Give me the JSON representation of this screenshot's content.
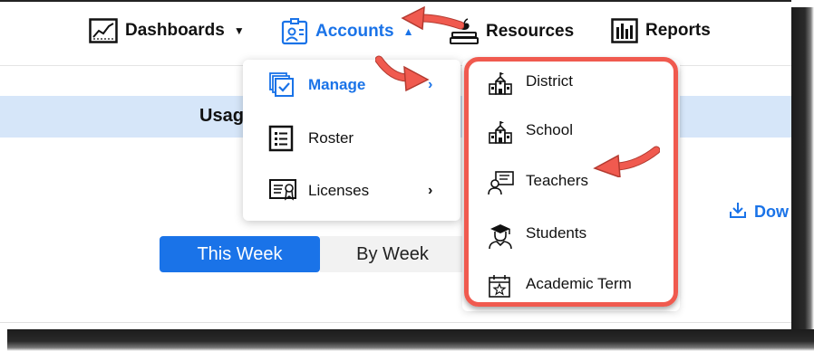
{
  "nav": {
    "items": [
      {
        "label": "Dashboards",
        "icon": "chart-line-icon",
        "active": false
      },
      {
        "label": "Accounts",
        "icon": "account-card-icon",
        "active": true
      },
      {
        "label": "Resources",
        "icon": "apple-books-icon",
        "active": false
      },
      {
        "label": "Reports",
        "icon": "bar-chart-icon",
        "active": false
      }
    ]
  },
  "page": {
    "section_title": "Usag",
    "download_label": "Dow",
    "toggle": {
      "selected": "This Week",
      "other": "By Week"
    }
  },
  "accounts_menu": {
    "items": [
      {
        "label": "Manage",
        "icon": "copy-check-icon",
        "has_submenu": true,
        "active": true
      },
      {
        "label": "Roster",
        "icon": "checklist-icon",
        "has_submenu": false
      },
      {
        "label": "Licenses",
        "icon": "certificate-icon",
        "has_submenu": true
      }
    ]
  },
  "manage_submenu": {
    "items": [
      {
        "label": "District",
        "icon": "school-building-icon"
      },
      {
        "label": "School",
        "icon": "school-building-icon"
      },
      {
        "label": "Teachers",
        "icon": "teacher-board-icon"
      },
      {
        "label": "Students",
        "icon": "graduate-icon"
      },
      {
        "label": "Academic Term",
        "icon": "calendar-star-icon"
      }
    ]
  },
  "colors": {
    "accent": "#1a73e8",
    "highlight": "#f05a4f",
    "band": "#d6e6f9"
  }
}
